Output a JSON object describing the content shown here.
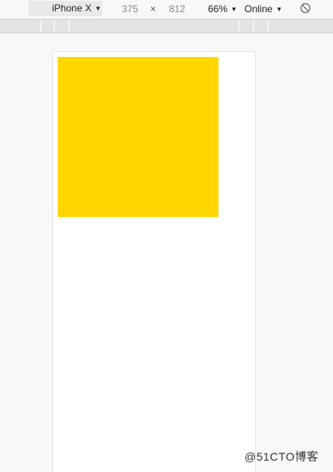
{
  "toolbar": {
    "device": "iPhone X",
    "width_value": "375",
    "times_symbol": "×",
    "height_value": "812",
    "zoom": "66%",
    "throttling": "Online"
  },
  "colors": {
    "box": "#FFD700"
  },
  "watermark": "@51CTO博客"
}
